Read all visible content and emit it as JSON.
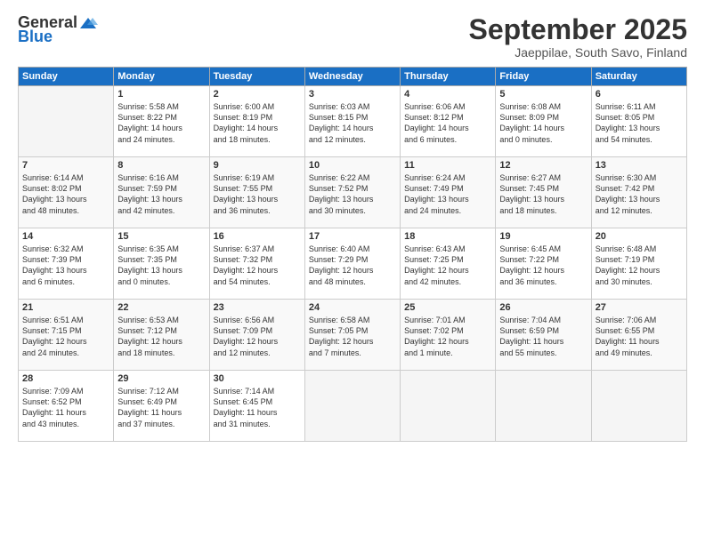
{
  "header": {
    "logo_general": "General",
    "logo_blue": "Blue",
    "month": "September 2025",
    "location": "Jaeppilae, South Savo, Finland"
  },
  "weekdays": [
    "Sunday",
    "Monday",
    "Tuesday",
    "Wednesday",
    "Thursday",
    "Friday",
    "Saturday"
  ],
  "weeks": [
    [
      {
        "day": "",
        "content": ""
      },
      {
        "day": "1",
        "content": "Sunrise: 5:58 AM\nSunset: 8:22 PM\nDaylight: 14 hours\nand 24 minutes."
      },
      {
        "day": "2",
        "content": "Sunrise: 6:00 AM\nSunset: 8:19 PM\nDaylight: 14 hours\nand 18 minutes."
      },
      {
        "day": "3",
        "content": "Sunrise: 6:03 AM\nSunset: 8:15 PM\nDaylight: 14 hours\nand 12 minutes."
      },
      {
        "day": "4",
        "content": "Sunrise: 6:06 AM\nSunset: 8:12 PM\nDaylight: 14 hours\nand 6 minutes."
      },
      {
        "day": "5",
        "content": "Sunrise: 6:08 AM\nSunset: 8:09 PM\nDaylight: 14 hours\nand 0 minutes."
      },
      {
        "day": "6",
        "content": "Sunrise: 6:11 AM\nSunset: 8:05 PM\nDaylight: 13 hours\nand 54 minutes."
      }
    ],
    [
      {
        "day": "7",
        "content": "Sunrise: 6:14 AM\nSunset: 8:02 PM\nDaylight: 13 hours\nand 48 minutes."
      },
      {
        "day": "8",
        "content": "Sunrise: 6:16 AM\nSunset: 7:59 PM\nDaylight: 13 hours\nand 42 minutes."
      },
      {
        "day": "9",
        "content": "Sunrise: 6:19 AM\nSunset: 7:55 PM\nDaylight: 13 hours\nand 36 minutes."
      },
      {
        "day": "10",
        "content": "Sunrise: 6:22 AM\nSunset: 7:52 PM\nDaylight: 13 hours\nand 30 minutes."
      },
      {
        "day": "11",
        "content": "Sunrise: 6:24 AM\nSunset: 7:49 PM\nDaylight: 13 hours\nand 24 minutes."
      },
      {
        "day": "12",
        "content": "Sunrise: 6:27 AM\nSunset: 7:45 PM\nDaylight: 13 hours\nand 18 minutes."
      },
      {
        "day": "13",
        "content": "Sunrise: 6:30 AM\nSunset: 7:42 PM\nDaylight: 13 hours\nand 12 minutes."
      }
    ],
    [
      {
        "day": "14",
        "content": "Sunrise: 6:32 AM\nSunset: 7:39 PM\nDaylight: 13 hours\nand 6 minutes."
      },
      {
        "day": "15",
        "content": "Sunrise: 6:35 AM\nSunset: 7:35 PM\nDaylight: 13 hours\nand 0 minutes."
      },
      {
        "day": "16",
        "content": "Sunrise: 6:37 AM\nSunset: 7:32 PM\nDaylight: 12 hours\nand 54 minutes."
      },
      {
        "day": "17",
        "content": "Sunrise: 6:40 AM\nSunset: 7:29 PM\nDaylight: 12 hours\nand 48 minutes."
      },
      {
        "day": "18",
        "content": "Sunrise: 6:43 AM\nSunset: 7:25 PM\nDaylight: 12 hours\nand 42 minutes."
      },
      {
        "day": "19",
        "content": "Sunrise: 6:45 AM\nSunset: 7:22 PM\nDaylight: 12 hours\nand 36 minutes."
      },
      {
        "day": "20",
        "content": "Sunrise: 6:48 AM\nSunset: 7:19 PM\nDaylight: 12 hours\nand 30 minutes."
      }
    ],
    [
      {
        "day": "21",
        "content": "Sunrise: 6:51 AM\nSunset: 7:15 PM\nDaylight: 12 hours\nand 24 minutes."
      },
      {
        "day": "22",
        "content": "Sunrise: 6:53 AM\nSunset: 7:12 PM\nDaylight: 12 hours\nand 18 minutes."
      },
      {
        "day": "23",
        "content": "Sunrise: 6:56 AM\nSunset: 7:09 PM\nDaylight: 12 hours\nand 12 minutes."
      },
      {
        "day": "24",
        "content": "Sunrise: 6:58 AM\nSunset: 7:05 PM\nDaylight: 12 hours\nand 7 minutes."
      },
      {
        "day": "25",
        "content": "Sunrise: 7:01 AM\nSunset: 7:02 PM\nDaylight: 12 hours\nand 1 minute."
      },
      {
        "day": "26",
        "content": "Sunrise: 7:04 AM\nSunset: 6:59 PM\nDaylight: 11 hours\nand 55 minutes."
      },
      {
        "day": "27",
        "content": "Sunrise: 7:06 AM\nSunset: 6:55 PM\nDaylight: 11 hours\nand 49 minutes."
      }
    ],
    [
      {
        "day": "28",
        "content": "Sunrise: 7:09 AM\nSunset: 6:52 PM\nDaylight: 11 hours\nand 43 minutes."
      },
      {
        "day": "29",
        "content": "Sunrise: 7:12 AM\nSunset: 6:49 PM\nDaylight: 11 hours\nand 37 minutes."
      },
      {
        "day": "30",
        "content": "Sunrise: 7:14 AM\nSunset: 6:45 PM\nDaylight: 11 hours\nand 31 minutes."
      },
      {
        "day": "",
        "content": ""
      },
      {
        "day": "",
        "content": ""
      },
      {
        "day": "",
        "content": ""
      },
      {
        "day": "",
        "content": ""
      }
    ]
  ]
}
